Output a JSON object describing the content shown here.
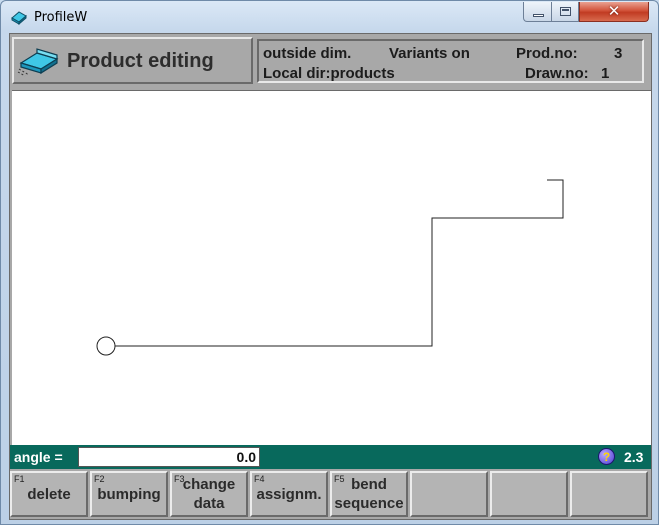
{
  "window": {
    "title": "ProfileW",
    "close_glyph": "✕"
  },
  "header": {
    "title": "Product editing",
    "dimension_mode": "outside dim.",
    "variants": "Variants on",
    "prod_no_label": "Prod.no:",
    "prod_no": "3",
    "local_dir": "Local dir:products",
    "draw_no_label": "Draw.no:",
    "draw_no": "1"
  },
  "status": {
    "angle_label": "angle =",
    "angle_value": "0.0",
    "version": "2.3",
    "help_glyph": "?"
  },
  "fkeys": [
    {
      "key": "F1",
      "line1": "delete",
      "line2": ""
    },
    {
      "key": "F2",
      "line1": "bumping",
      "line2": ""
    },
    {
      "key": "F3",
      "line1": "change",
      "line2": "data"
    },
    {
      "key": "F4",
      "line1": "assignm.",
      "line2": ""
    },
    {
      "key": "F5",
      "line1": "bend",
      "line2": "sequence"
    },
    {
      "key": "",
      "line1": "",
      "line2": ""
    },
    {
      "key": "",
      "line1": "",
      "line2": ""
    },
    {
      "key": "",
      "line1": "",
      "line2": ""
    }
  ],
  "icons": {
    "app": "profile-icon",
    "header": "sheet-metal-part-icon",
    "help": "help-icon"
  },
  "colors": {
    "status_bar": "#08695c",
    "panel_gray": "#a8a8a8",
    "close_red": "#c13b22",
    "icon_cyan": "#3fc7e6"
  }
}
